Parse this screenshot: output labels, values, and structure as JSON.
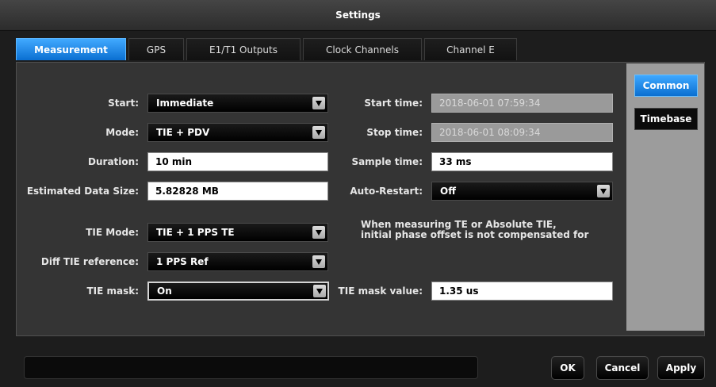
{
  "window": {
    "title": "Settings"
  },
  "tabs": [
    {
      "label": "Measurement",
      "active": true
    },
    {
      "label": "GPS",
      "active": false
    },
    {
      "label": "E1/T1 Outputs",
      "active": false
    },
    {
      "label": "Clock Channels",
      "active": false
    },
    {
      "label": "Channel E",
      "active": false
    }
  ],
  "side": {
    "common_label": "Common",
    "timebase_label": "Timebase"
  },
  "form": {
    "start": {
      "label": "Start:",
      "value": "Immediate"
    },
    "mode": {
      "label": "Mode:",
      "value": "TIE + PDV"
    },
    "duration": {
      "label": "Duration:",
      "value": "10 min"
    },
    "data_size": {
      "label": "Estimated Data Size:",
      "value": "5.82828 MB"
    },
    "tie_mode": {
      "label": "TIE Mode:",
      "value": "TIE + 1 PPS TE"
    },
    "diff_tie_ref": {
      "label": "Diff TIE reference:",
      "value": "1 PPS Ref"
    },
    "tie_mask": {
      "label": "TIE mask:",
      "value": "On"
    },
    "start_time": {
      "label": "Start time:",
      "value": "2018-06-01 07:59:34"
    },
    "stop_time": {
      "label": "Stop time:",
      "value": "2018-06-01 08:09:34"
    },
    "sample_time": {
      "label": "Sample time:",
      "value": "33 ms"
    },
    "auto_restart": {
      "label": "Auto-Restart:",
      "value": "Off"
    },
    "tie_mask_value": {
      "label": "TIE mask value:",
      "value": "1.35 us"
    },
    "note": {
      "line1": "When measuring TE or Absolute TIE,",
      "line2": "initial phase offset is not compensated for"
    }
  },
  "footer": {
    "ok_label": "OK",
    "cancel_label": "Cancel",
    "apply_label": "Apply"
  },
  "colors": {
    "accent": "#1a8cf0",
    "panel": "#343434",
    "side_panel": "#9c9c9c"
  },
  "icons": {
    "dropdown": "dropdown-arrow-icon"
  }
}
